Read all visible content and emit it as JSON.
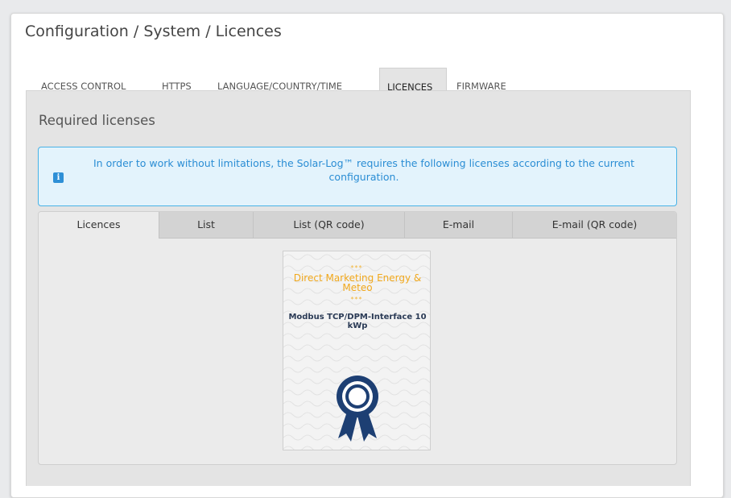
{
  "page": {
    "title": "Configuration / System / Licences"
  },
  "top_tabs": [
    {
      "label": "ACCESS CONTROL",
      "active": false
    },
    {
      "label": "HTTPS",
      "active": false
    },
    {
      "label": "LANGUAGE/COUNTRY/TIME",
      "active": false
    },
    {
      "label": "LICENCES",
      "active": true
    },
    {
      "label": "FIRMWARE",
      "active": false
    }
  ],
  "section": {
    "title": "Required licenses"
  },
  "info": {
    "icon": "info-icon",
    "text": "In order to work without limitations, the Solar-Log™ requires the following licenses according to the current configuration."
  },
  "inner_tabs": [
    {
      "label": "Licences",
      "active": true
    },
    {
      "label": "List",
      "active": false
    },
    {
      "label": "List (QR code)",
      "active": false
    },
    {
      "label": "E-mail",
      "active": false
    },
    {
      "label": "E-mail (QR code)",
      "active": false
    }
  ],
  "license_card": {
    "stars_top": "***",
    "name": "Direct Marketing Energy & Meteo",
    "stars_bottom": "***",
    "description": "Modbus TCP/DPM-Interface 10 kWp",
    "icon": "award-ribbon-icon"
  },
  "colors": {
    "info_border": "#48b2e6",
    "info_text": "#2a8dd4",
    "license_name": "#f1a81c",
    "award": "#1d3f73"
  }
}
